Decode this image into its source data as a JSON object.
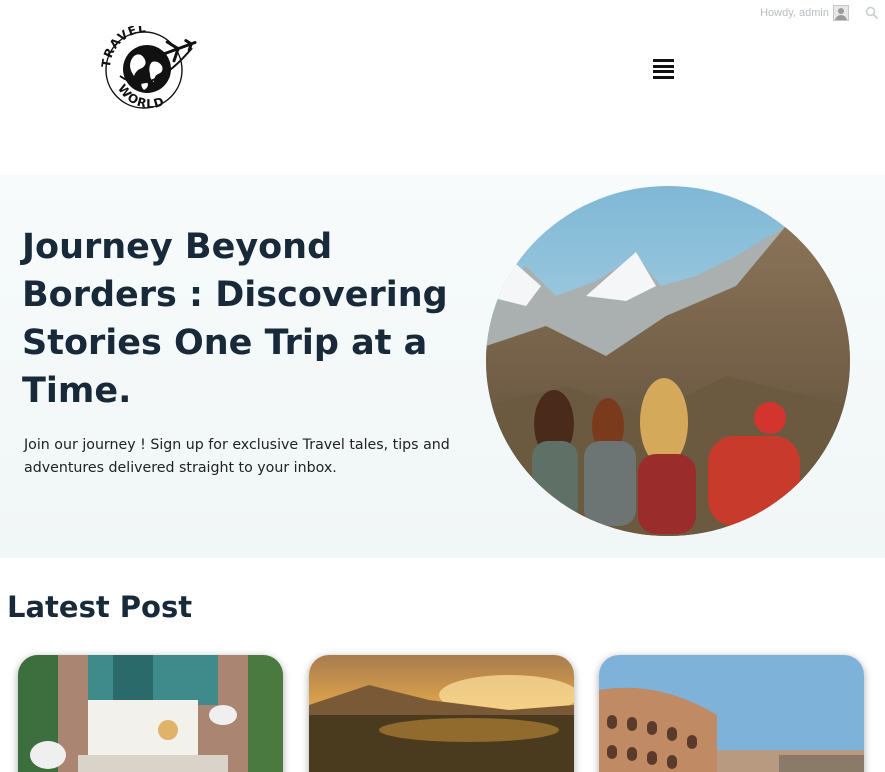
{
  "admin_bar": {
    "greeting": "Howdy, admin",
    "icons": [
      "avatar-icon",
      "search-icon"
    ]
  },
  "header": {
    "logo": {
      "text_top": "TRAVEL",
      "text_bottom": "WORLD",
      "icons": [
        "globe-icon",
        "airplane-icon"
      ]
    },
    "menu_icon": "hamburger-menu-icon"
  },
  "hero": {
    "title": "Journey Beyond Borders : Discovering Stories One Trip at a Time.",
    "subtitle": "Join our journey ! Sign up for exclusive Travel tales, tips and adventures delivered straight to your inbox.",
    "image": "travelers-overlooking-snowy-mountains"
  },
  "latest": {
    "heading": "Latest Post",
    "cards": [
      {
        "image": "lounge-terrace-with-daybeds"
      },
      {
        "image": "sunset-over-valley"
      },
      {
        "image": "colosseum-rome"
      }
    ]
  },
  "colors": {
    "heading": "#18293a",
    "hero_bg": "#f3f8f8",
    "admin_text": "#b8bec4"
  }
}
